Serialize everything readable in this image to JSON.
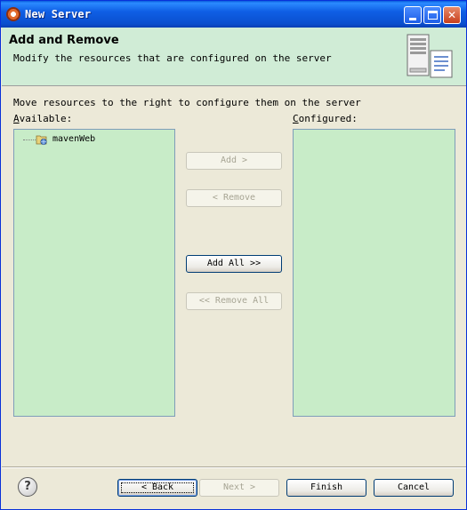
{
  "window": {
    "title": "New Server",
    "controls": {
      "minimize": "",
      "maximize": "",
      "close": "✕"
    }
  },
  "header": {
    "title": "Add and Remove",
    "description": "Modify the resources that are configured on the server"
  },
  "main": {
    "instruction": "Move resources to the right to configure them on the server",
    "available_label": {
      "mnemonic": "A",
      "rest": "vailable:"
    },
    "configured_label": {
      "mnemonic": "C",
      "rest": "onfigured:"
    },
    "available_items": [
      {
        "label": "mavenWeb",
        "icon": "web-project-icon"
      }
    ],
    "configured_items": []
  },
  "transfer_buttons": {
    "add": {
      "label": "Add >",
      "enabled": false
    },
    "remove": {
      "label": "< Remove",
      "enabled": false
    },
    "add_all": {
      "label": "Add All >>",
      "enabled": true
    },
    "remove_all": {
      "label": "<< Remove All",
      "enabled": false
    }
  },
  "footer": {
    "help": "?",
    "back": "< Back",
    "next": "Next >",
    "finish": "Finish",
    "cancel": "Cancel"
  },
  "colors": {
    "list_background": "#c8ecc8",
    "header_background": "#d0ecd6",
    "dialog_background": "#ece9d8",
    "titlebar_blue": "#0a5ddd"
  }
}
